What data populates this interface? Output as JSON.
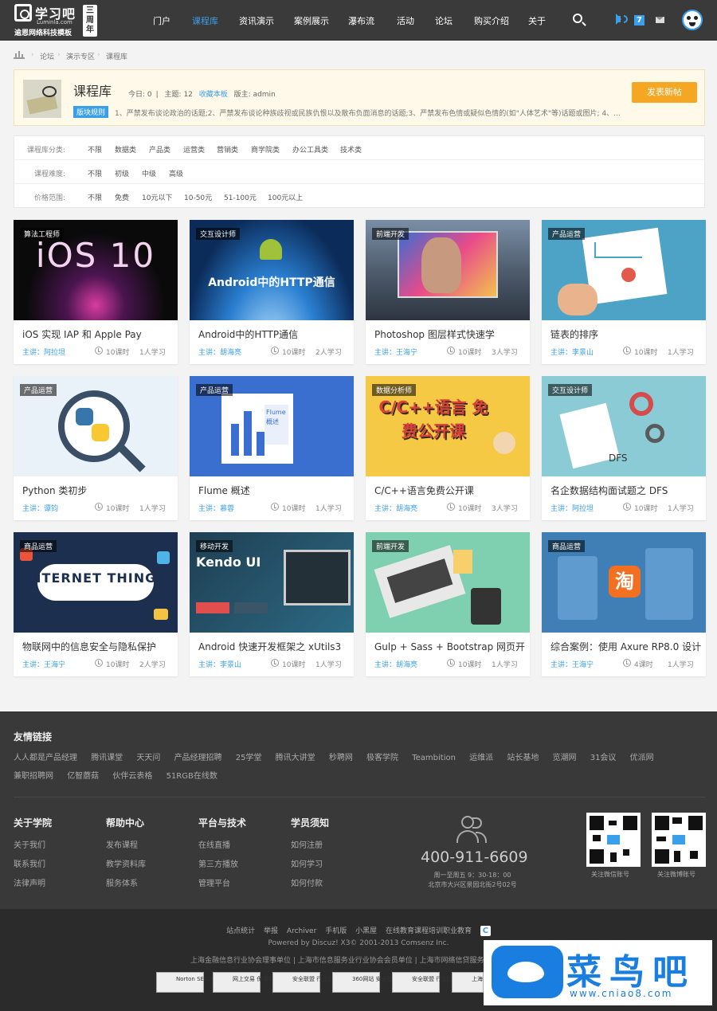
{
  "header": {
    "logo_cn": "学习吧",
    "logo_en": "Luminla.com",
    "logo_sub": "逾恩网络科技模板",
    "logo_badge": "三周年",
    "nav": [
      "门户",
      "课程库",
      "资讯演示",
      "案例展示",
      "瀑布流",
      "活动",
      "论坛",
      "购买介绍",
      "关于"
    ],
    "active_nav": "课程库",
    "notice_count": "7"
  },
  "breadcrumb": [
    "论坛",
    "演示专区",
    "课程库"
  ],
  "forum": {
    "title": "课程库",
    "today": "今日: 0",
    "topics": "主题: 12",
    "favorite": "收藏本板",
    "moderator": "版主: admin",
    "rules_label": "版块规则",
    "rules_text": "1、严禁发布谈论政治的话题;2、严禁发布谈论种族歧视或民族仇恨以及散布负面消息的话题;3、严禁发布色情或疑似色情的(如\"人体艺术\"等)话题或图片; 4、...",
    "post_button": "发表新帖"
  },
  "filters": [
    {
      "label": "课程库分类:",
      "options": [
        "不限",
        "数据类",
        "产品类",
        "运营类",
        "营销类",
        "商学院类",
        "办公工具类",
        "技术类"
      ]
    },
    {
      "label": "课程难度:",
      "options": [
        "不限",
        "初级",
        "中级",
        "高级"
      ]
    },
    {
      "label": "价格范围:",
      "options": [
        "不限",
        "免费",
        "10元以下",
        "10-50元",
        "51-100元",
        "100元以上"
      ]
    }
  ],
  "courses": [
    {
      "tag": "算法工程师",
      "title": "iOS 实现 IAP 和 Apple Pay",
      "teacher": "主讲：阿拉坦",
      "lessons": "10课时",
      "learners": "1人学习",
      "thumb_text": "iOS 10"
    },
    {
      "tag": "交互设计师",
      "title": "Android中的HTTP通信",
      "teacher": "主讲：胡海亮",
      "lessons": "10课时",
      "learners": "2人学习",
      "thumb_text": "Android中的HTTP通信"
    },
    {
      "tag": "前端开发",
      "title": "Photoshop 图层样式快速学",
      "teacher": "主讲：王海宁",
      "lessons": "10课时",
      "learners": "3人学习",
      "thumb_text": ""
    },
    {
      "tag": "产品运营",
      "title": "链表的排序",
      "teacher": "主讲：李景山",
      "lessons": "10课时",
      "learners": "1人学习",
      "thumb_text": ""
    },
    {
      "tag": "产品运营",
      "title": "Python 类初步",
      "teacher": "主讲：谭钧",
      "lessons": "10课时",
      "learners": "1人学习",
      "thumb_text": ""
    },
    {
      "tag": "产品运营",
      "title": "Flume 概述",
      "teacher": "主讲：慕蓉",
      "lessons": "10课时",
      "learners": "1人学习",
      "thumb_text": "Flume 概述"
    },
    {
      "tag": "数据分析师",
      "title": "C/C++语言免费公开课",
      "teacher": "主讲：胡海亮",
      "lessons": "10课时",
      "learners": "3人学习",
      "thumb_text": "C/C++语言 免费公开课"
    },
    {
      "tag": "交互设计师",
      "title": "名企数据结构面试题之 DFS",
      "teacher": "主讲：阿拉坦",
      "lessons": "10课时",
      "learners": "1人学习",
      "thumb_text": "DFS"
    },
    {
      "tag": "商品运营",
      "title": "物联网中的信息安全与隐私保护",
      "teacher": "主讲：王海宁",
      "lessons": "10课时",
      "learners": "2人学习",
      "thumb_text": "INTERNET THINGS"
    },
    {
      "tag": "移动开发",
      "title": "Android 快速开发框架之 xUtils3",
      "teacher": "主讲：李景山",
      "lessons": "10课时",
      "learners": "1人学习",
      "thumb_text": "Kendo UI"
    },
    {
      "tag": "前端开发",
      "title": "Gulp + Sass + Bootstrap 网页开",
      "teacher": "主讲：胡海亮",
      "lessons": "10课时",
      "learners": "1人学习",
      "thumb_text": ""
    },
    {
      "tag": "商品运营",
      "title": "综合案例：使用 Axure RP8.0 设计",
      "teacher": "主讲：王海宁",
      "lessons": "4课时",
      "learners": "1人学习",
      "thumb_text": "淘"
    }
  ],
  "friend_links": {
    "title": "友情链接",
    "row1": [
      "人人都是产品经理",
      "腾讯课堂",
      "天天问",
      "产品经理招聘",
      "25学堂",
      "腾讯大讲堂",
      "秒聘网",
      "极客学院",
      "Teambition",
      "运维派",
      "站长基地",
      "览潮网",
      "31会议",
      "优派网"
    ],
    "row2": [
      "兼职招聘网",
      "亿智蘑菇",
      "伙伴云表格",
      "51RGB在线数"
    ]
  },
  "footer_cols": [
    {
      "title": "关于学院",
      "items": [
        "关于我们",
        "联系我们",
        "法律声明"
      ]
    },
    {
      "title": "帮助中心",
      "items": [
        "发布课程",
        "教学资料库",
        "服务体系"
      ]
    },
    {
      "title": "平台与技术",
      "items": [
        "在线直播",
        "第三方播放",
        "管理平台"
      ]
    },
    {
      "title": "学员须知",
      "items": [
        "如何注册",
        "如何学习",
        "如何付款"
      ]
    }
  ],
  "contact": {
    "phone": "400-911-6609",
    "hours": "周一至周五 9：30-18：00",
    "address": "北京市大兴区景园北街2号02号"
  },
  "qr": [
    "关注微信账号",
    "关注微博账号"
  ],
  "bottom": {
    "links": [
      "站点统计",
      "举报",
      "Archiver",
      "手机版",
      "小黑屋",
      "在线教育课程培训职业教育"
    ],
    "powered": "Powered by Discuz!  X3© 2001-2013 Comsenz Inc.",
    "units": "上海金融信息行业协会理事单位 | 上海市信息服务业行业协会会员单位 | 上海市网络信贷服务业",
    "seals": [
      "Norton SECURED",
      "网上交易 保障中心",
      "安全联盟 行业验证",
      "360网站 安全检测",
      "安全联盟 行业验证",
      "上海 违法"
    ]
  },
  "watermark": {
    "cn": "菜鸟吧",
    "url": "www.cniao8.com"
  }
}
